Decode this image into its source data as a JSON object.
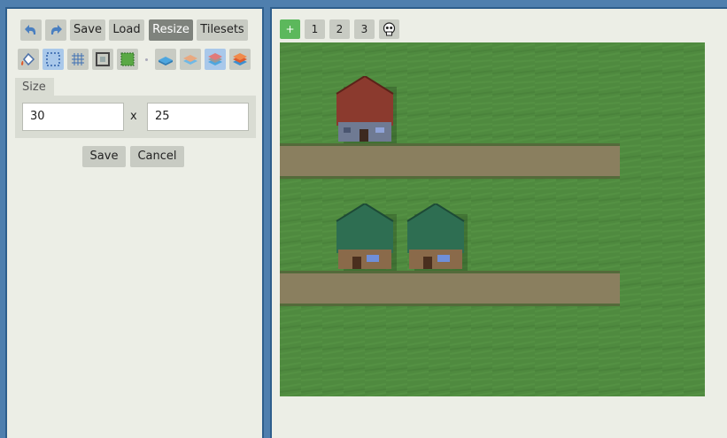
{
  "toolbar": {
    "save_label": "Save",
    "load_label": "Load",
    "resize_label": "Resize",
    "tilesets_label": "Tilesets"
  },
  "resize_panel": {
    "tab_label": "Size",
    "width_value": "30",
    "separator": "x",
    "height_value": "25",
    "save_label": "Save",
    "cancel_label": "Cancel"
  },
  "layers": {
    "add_label": "+",
    "layer_1": "1",
    "layer_2": "2",
    "layer_3": "3"
  },
  "colors": {
    "frame": "#2e5e8c",
    "panel_bg": "#eceee6",
    "button_bg": "#c8cbc3",
    "active_button": "#7f837d",
    "selected_tool": "#a9c8ea",
    "add_button": "#5cb85c",
    "grass": "#4f8a3f",
    "road": "#8a7f5f",
    "roof_red": "#8b3a2e",
    "roof_green": "#2e6e52"
  },
  "icons": [
    "undo-icon",
    "redo-icon",
    "fill-bucket-icon",
    "selection-icon",
    "grid-icon",
    "frame-icon",
    "green-selection-icon",
    "blue-layer-icon",
    "light-blue-layer-icon",
    "red-layer-icon",
    "orange-layer-icon",
    "skull-icon"
  ]
}
